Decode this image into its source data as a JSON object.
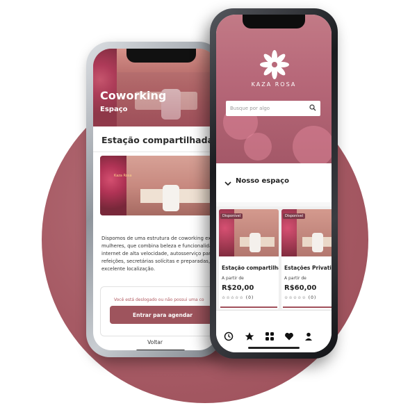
{
  "back_screen": {
    "hero_title": "Coworking",
    "hero_subtitle": "Espaço",
    "heading": "Estação compartilhada",
    "photo_logo": "Kaza Rosa",
    "description_lines": [
      "Dispomos de uma estrutura de coworking excl",
      "mulheres, que combina beleza e funcionalidad",
      "internet de alta velocidade, autosserviço para",
      "refeições, secretárias solícitas e preparadas, e",
      "excelente localização."
    ],
    "warning": "Você está deslogado ou não possui uma co",
    "cta_label": "Entrar para agendar",
    "back_label": "Voltar"
  },
  "front_screen": {
    "brand": "KAZA ROSA",
    "search": {
      "placeholder": "Busque por algo"
    },
    "section_title": "Nosso espaço",
    "cards": [
      {
        "badge": "Disponível",
        "name": "Estação compartilhada",
        "from": "A partir de",
        "price": "R$20,00",
        "rating": "☆☆☆☆☆ (0)"
      },
      {
        "badge": "Disponível",
        "name": "Estações Privativas",
        "from": "A partir de",
        "price": "R$60,00",
        "rating": "☆☆☆☆☆ (0)"
      }
    ],
    "nav": [
      "clock-icon",
      "star-icon",
      "grid-icon",
      "heart-icon",
      "user-icon"
    ]
  },
  "colors": {
    "brand_rose": "#9e545d",
    "circle": "#a65a64",
    "front_phone": "#1a1b1f",
    "back_phone": "#c9cdd2"
  }
}
